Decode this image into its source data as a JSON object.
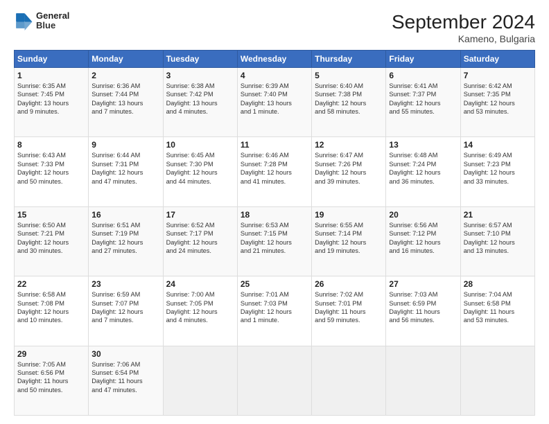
{
  "logo": {
    "line1": "General",
    "line2": "Blue"
  },
  "title": "September 2024",
  "subtitle": "Kameno, Bulgaria",
  "weekdays": [
    "Sunday",
    "Monday",
    "Tuesday",
    "Wednesday",
    "Thursday",
    "Friday",
    "Saturday"
  ],
  "weeks": [
    [
      {
        "day": "1",
        "lines": [
          "Sunrise: 6:35 AM",
          "Sunset: 7:45 PM",
          "Daylight: 13 hours",
          "and 9 minutes."
        ]
      },
      {
        "day": "2",
        "lines": [
          "Sunrise: 6:36 AM",
          "Sunset: 7:44 PM",
          "Daylight: 13 hours",
          "and 7 minutes."
        ]
      },
      {
        "day": "3",
        "lines": [
          "Sunrise: 6:38 AM",
          "Sunset: 7:42 PM",
          "Daylight: 13 hours",
          "and 4 minutes."
        ]
      },
      {
        "day": "4",
        "lines": [
          "Sunrise: 6:39 AM",
          "Sunset: 7:40 PM",
          "Daylight: 13 hours",
          "and 1 minute."
        ]
      },
      {
        "day": "5",
        "lines": [
          "Sunrise: 6:40 AM",
          "Sunset: 7:38 PM",
          "Daylight: 12 hours",
          "and 58 minutes."
        ]
      },
      {
        "day": "6",
        "lines": [
          "Sunrise: 6:41 AM",
          "Sunset: 7:37 PM",
          "Daylight: 12 hours",
          "and 55 minutes."
        ]
      },
      {
        "day": "7",
        "lines": [
          "Sunrise: 6:42 AM",
          "Sunset: 7:35 PM",
          "Daylight: 12 hours",
          "and 53 minutes."
        ]
      }
    ],
    [
      {
        "day": "8",
        "lines": [
          "Sunrise: 6:43 AM",
          "Sunset: 7:33 PM",
          "Daylight: 12 hours",
          "and 50 minutes."
        ]
      },
      {
        "day": "9",
        "lines": [
          "Sunrise: 6:44 AM",
          "Sunset: 7:31 PM",
          "Daylight: 12 hours",
          "and 47 minutes."
        ]
      },
      {
        "day": "10",
        "lines": [
          "Sunrise: 6:45 AM",
          "Sunset: 7:30 PM",
          "Daylight: 12 hours",
          "and 44 minutes."
        ]
      },
      {
        "day": "11",
        "lines": [
          "Sunrise: 6:46 AM",
          "Sunset: 7:28 PM",
          "Daylight: 12 hours",
          "and 41 minutes."
        ]
      },
      {
        "day": "12",
        "lines": [
          "Sunrise: 6:47 AM",
          "Sunset: 7:26 PM",
          "Daylight: 12 hours",
          "and 39 minutes."
        ]
      },
      {
        "day": "13",
        "lines": [
          "Sunrise: 6:48 AM",
          "Sunset: 7:24 PM",
          "Daylight: 12 hours",
          "and 36 minutes."
        ]
      },
      {
        "day": "14",
        "lines": [
          "Sunrise: 6:49 AM",
          "Sunset: 7:23 PM",
          "Daylight: 12 hours",
          "and 33 minutes."
        ]
      }
    ],
    [
      {
        "day": "15",
        "lines": [
          "Sunrise: 6:50 AM",
          "Sunset: 7:21 PM",
          "Daylight: 12 hours",
          "and 30 minutes."
        ]
      },
      {
        "day": "16",
        "lines": [
          "Sunrise: 6:51 AM",
          "Sunset: 7:19 PM",
          "Daylight: 12 hours",
          "and 27 minutes."
        ]
      },
      {
        "day": "17",
        "lines": [
          "Sunrise: 6:52 AM",
          "Sunset: 7:17 PM",
          "Daylight: 12 hours",
          "and 24 minutes."
        ]
      },
      {
        "day": "18",
        "lines": [
          "Sunrise: 6:53 AM",
          "Sunset: 7:15 PM",
          "Daylight: 12 hours",
          "and 21 minutes."
        ]
      },
      {
        "day": "19",
        "lines": [
          "Sunrise: 6:55 AM",
          "Sunset: 7:14 PM",
          "Daylight: 12 hours",
          "and 19 minutes."
        ]
      },
      {
        "day": "20",
        "lines": [
          "Sunrise: 6:56 AM",
          "Sunset: 7:12 PM",
          "Daylight: 12 hours",
          "and 16 minutes."
        ]
      },
      {
        "day": "21",
        "lines": [
          "Sunrise: 6:57 AM",
          "Sunset: 7:10 PM",
          "Daylight: 12 hours",
          "and 13 minutes."
        ]
      }
    ],
    [
      {
        "day": "22",
        "lines": [
          "Sunrise: 6:58 AM",
          "Sunset: 7:08 PM",
          "Daylight: 12 hours",
          "and 10 minutes."
        ]
      },
      {
        "day": "23",
        "lines": [
          "Sunrise: 6:59 AM",
          "Sunset: 7:07 PM",
          "Daylight: 12 hours",
          "and 7 minutes."
        ]
      },
      {
        "day": "24",
        "lines": [
          "Sunrise: 7:00 AM",
          "Sunset: 7:05 PM",
          "Daylight: 12 hours",
          "and 4 minutes."
        ]
      },
      {
        "day": "25",
        "lines": [
          "Sunrise: 7:01 AM",
          "Sunset: 7:03 PM",
          "Daylight: 12 hours",
          "and 1 minute."
        ]
      },
      {
        "day": "26",
        "lines": [
          "Sunrise: 7:02 AM",
          "Sunset: 7:01 PM",
          "Daylight: 11 hours",
          "and 59 minutes."
        ]
      },
      {
        "day": "27",
        "lines": [
          "Sunrise: 7:03 AM",
          "Sunset: 6:59 PM",
          "Daylight: 11 hours",
          "and 56 minutes."
        ]
      },
      {
        "day": "28",
        "lines": [
          "Sunrise: 7:04 AM",
          "Sunset: 6:58 PM",
          "Daylight: 11 hours",
          "and 53 minutes."
        ]
      }
    ],
    [
      {
        "day": "29",
        "lines": [
          "Sunrise: 7:05 AM",
          "Sunset: 6:56 PM",
          "Daylight: 11 hours",
          "and 50 minutes."
        ]
      },
      {
        "day": "30",
        "lines": [
          "Sunrise: 7:06 AM",
          "Sunset: 6:54 PM",
          "Daylight: 11 hours",
          "and 47 minutes."
        ]
      },
      {
        "day": "",
        "lines": []
      },
      {
        "day": "",
        "lines": []
      },
      {
        "day": "",
        "lines": []
      },
      {
        "day": "",
        "lines": []
      },
      {
        "day": "",
        "lines": []
      }
    ]
  ]
}
